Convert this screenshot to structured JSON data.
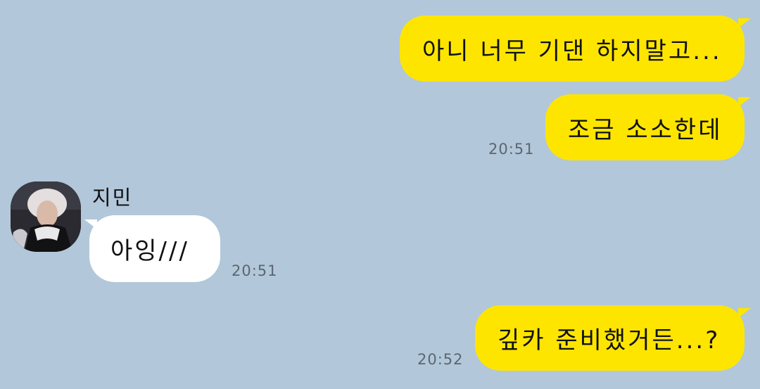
{
  "messages": [
    {
      "direction": "outgoing",
      "text": "아니 너무 기댄 하지말고...",
      "time": ""
    },
    {
      "direction": "outgoing",
      "text": "조금 소소한데",
      "time": "20:51"
    },
    {
      "direction": "incoming",
      "sender": "지민",
      "text": "아잉///",
      "time": "20:51"
    },
    {
      "direction": "outgoing",
      "text": "깊카 준비했거든...?",
      "time": "20:52"
    }
  ],
  "colors": {
    "background": "#b2c7da",
    "outgoing_bubble": "#fee500",
    "incoming_bubble": "#ffffff",
    "timestamp": "#5c6670"
  },
  "icons": {
    "avatar": "profile-photo"
  }
}
